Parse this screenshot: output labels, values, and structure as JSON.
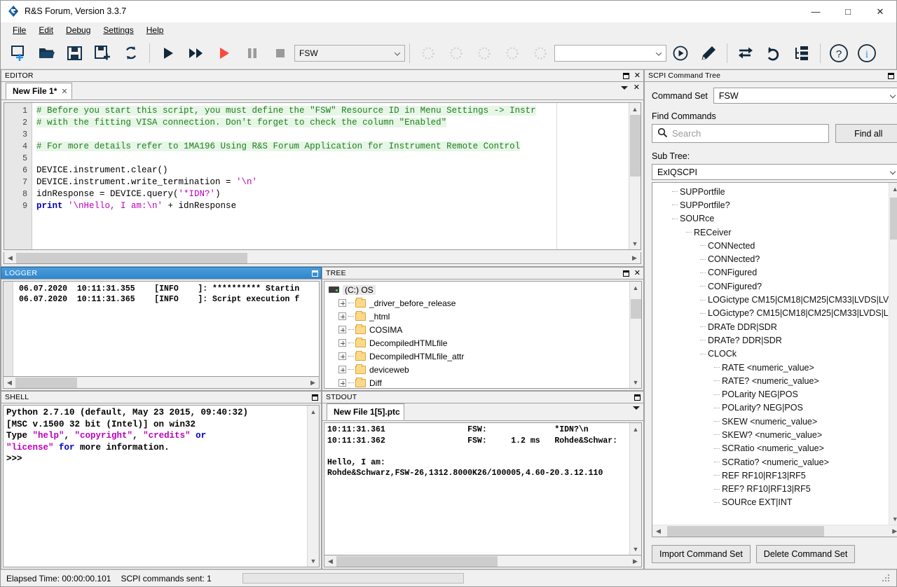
{
  "window": {
    "title": "R&S Forum, Version 3.3.7",
    "icon": "rs-logo-icon",
    "minimize": "—",
    "maximize": "□",
    "close": "✕"
  },
  "menu": {
    "items": [
      "File",
      "Edit",
      "Debug",
      "Settings",
      "Help"
    ]
  },
  "toolbar": {
    "buttons": [
      {
        "name": "new-file-icon",
        "title": "New File"
      },
      {
        "name": "open-folder-icon",
        "title": "Open"
      },
      {
        "name": "save-icon",
        "title": "Save"
      },
      {
        "name": "save-as-icon",
        "title": "Save As"
      },
      {
        "name": "refresh-icon",
        "title": "Reload"
      },
      {
        "name": "run-icon",
        "title": "Run"
      },
      {
        "name": "step-forward-icon",
        "title": "Run Fast"
      },
      {
        "name": "run-red-icon",
        "title": "Execute"
      },
      {
        "name": "pause-icon",
        "title": "Pause"
      },
      {
        "name": "stop-icon",
        "title": "Stop"
      }
    ],
    "device_combo": "FSW",
    "macro_combo": "",
    "right_buttons": [
      {
        "name": "play-circle-icon",
        "title": "Run Macro"
      },
      {
        "name": "pencil-icon",
        "title": "Edit Macro"
      },
      {
        "name": "swap-arrows-icon",
        "title": "Transfer"
      },
      {
        "name": "undo-icon",
        "title": "Undo"
      },
      {
        "name": "tree-list-icon",
        "title": "Command Tree"
      },
      {
        "name": "help-icon",
        "title": "Help"
      },
      {
        "name": "info-icon",
        "title": "Info"
      }
    ]
  },
  "editor": {
    "panel_title": "EDITOR",
    "tab_label": "New File 1*",
    "tab_close": "✕",
    "lines": [
      {
        "n": "1",
        "segments": [
          {
            "t": "# Before you start this script, you must define the \"FSW\" Resource ID in Menu Settings -> Instr",
            "c": "cm"
          }
        ]
      },
      {
        "n": "2",
        "segments": [
          {
            "t": "# with the fitting VISA connection. Don't forget to check the column \"Enabled\"",
            "c": "cm"
          }
        ]
      },
      {
        "n": "3",
        "segments": []
      },
      {
        "n": "4",
        "segments": [
          {
            "t": "# For more details refer to 1MA196 Using R&S Forum Application for Instrument Remote Control",
            "c": "cm"
          }
        ]
      },
      {
        "n": "5",
        "segments": []
      },
      {
        "n": "6",
        "segments": [
          {
            "t": "DEVICE.instrument.clear()",
            "c": ""
          }
        ]
      },
      {
        "n": "7",
        "segments": [
          {
            "t": "DEVICE.instrument.write_termination = ",
            "c": ""
          },
          {
            "t": "'\\n'",
            "c": "str-m"
          }
        ]
      },
      {
        "n": "8",
        "segments": [
          {
            "t": "idnResponse = DEVICE.query(",
            "c": ""
          },
          {
            "t": "'*IDN?'",
            "c": "str-m"
          },
          {
            "t": ")",
            "c": ""
          }
        ]
      },
      {
        "n": "9",
        "segments": [
          {
            "t": "print ",
            "c": "py-kw"
          },
          {
            "t": "'\\nHello, I am:\\n'",
            "c": "str-m"
          },
          {
            "t": " + idnResponse",
            "c": ""
          }
        ]
      }
    ]
  },
  "logger": {
    "panel_title": "LOGGER",
    "lines": [
      "06.07.2020  10:11:31.355    [INFO    ]: ********** Startin",
      "06.07.2020  10:11:31.365    [INFO    ]: Script execution f"
    ]
  },
  "tree": {
    "panel_title": "TREE",
    "items": [
      {
        "label": "(C:) OS",
        "indent": 0,
        "icon": "drive-icon",
        "expandable": false,
        "selected": true
      },
      {
        "label": "_driver_before_release",
        "indent": 1,
        "icon": "folder-icon",
        "expandable": true,
        "selected": false
      },
      {
        "label": "_html",
        "indent": 1,
        "icon": "folder-icon",
        "expandable": true,
        "selected": false
      },
      {
        "label": "COSIMA",
        "indent": 1,
        "icon": "folder-icon",
        "expandable": true,
        "selected": false
      },
      {
        "label": "DecompiledHTMLfile",
        "indent": 1,
        "icon": "folder-icon",
        "expandable": true,
        "selected": false
      },
      {
        "label": "DecompiledHTMLfile_attr",
        "indent": 1,
        "icon": "folder-icon",
        "expandable": true,
        "selected": false
      },
      {
        "label": "deviceweb",
        "indent": 1,
        "icon": "folder-icon",
        "expandable": true,
        "selected": false
      },
      {
        "label": "Diff",
        "indent": 1,
        "icon": "folder-icon",
        "expandable": true,
        "selected": false
      }
    ]
  },
  "shell": {
    "panel_title": "SHELL",
    "lines": [
      [
        {
          "t": "Python 2.7.10 (default, May 23 2015, 09:40:32)",
          "c": ""
        }
      ],
      [
        {
          "t": "[MSC v.1500 32 bit (Intel)] on win32",
          "c": ""
        }
      ],
      [
        {
          "t": "Type ",
          "c": ""
        },
        {
          "t": "\"help\"",
          "c": "s-str"
        },
        {
          "t": ", ",
          "c": ""
        },
        {
          "t": "\"copyright\"",
          "c": "s-str"
        },
        {
          "t": ", ",
          "c": ""
        },
        {
          "t": "\"credits\"",
          "c": "s-str"
        },
        {
          "t": " ",
          "c": ""
        },
        {
          "t": "or",
          "c": "s-kw"
        }
      ],
      [
        {
          "t": "\"license\"",
          "c": "s-str"
        },
        {
          "t": " ",
          "c": ""
        },
        {
          "t": "for",
          "c": "s-kw"
        },
        {
          "t": " more information.",
          "c": ""
        }
      ],
      [
        {
          "t": ">>>",
          "c": ""
        }
      ]
    ]
  },
  "stdout": {
    "panel_title": "STDOUT",
    "tab_label": "New File 1[5].ptc",
    "lines": [
      "10:11:31.361                 FSW:              *IDN?\\n",
      "10:11:31.362                 FSW:     1.2 ms   Rohde&Schwar:",
      "",
      "Hello, I am:",
      "Rohde&Schwarz,FSW-26,1312.8000K26/100005,4.60-20.3.12.110"
    ]
  },
  "scpi": {
    "panel_title": "SCPI Command Tree",
    "command_set_label": "Command Set",
    "command_set_value": "FSW",
    "find_label": "Find Commands",
    "search_placeholder": "Search",
    "search_value": "",
    "find_all_label": "Find all",
    "sub_tree_label": "Sub Tree:",
    "sub_tree_value": "ExIQSCPI",
    "import_label": "Import Command Set",
    "delete_label": "Delete Command Set",
    "items": [
      {
        "label": "SUPPortfile",
        "indent": 1
      },
      {
        "label": "SUPPortfile?",
        "indent": 1
      },
      {
        "label": "SOURce",
        "indent": 1
      },
      {
        "label": "RECeiver",
        "indent": 2
      },
      {
        "label": "CONNected",
        "indent": 3
      },
      {
        "label": "CONNected?",
        "indent": 3
      },
      {
        "label": "CONFigured",
        "indent": 3
      },
      {
        "label": "CONFigured?",
        "indent": 3
      },
      {
        "label": "LOGictype CM15|CM18|CM25|CM33|LVDS|LV",
        "indent": 3
      },
      {
        "label": "LOGictype? CM15|CM18|CM25|CM33|LVDS|L",
        "indent": 3
      },
      {
        "label": "DRATe DDR|SDR",
        "indent": 3
      },
      {
        "label": "DRATe? DDR|SDR",
        "indent": 3
      },
      {
        "label": "CLOCk",
        "indent": 3
      },
      {
        "label": "RATE <numeric_value>",
        "indent": 4
      },
      {
        "label": "RATE? <numeric_value>",
        "indent": 4
      },
      {
        "label": "POLarity NEG|POS",
        "indent": 4
      },
      {
        "label": "POLarity? NEG|POS",
        "indent": 4
      },
      {
        "label": "SKEW <numeric_value>",
        "indent": 4
      },
      {
        "label": "SKEW? <numeric_value>",
        "indent": 4
      },
      {
        "label": "SCRatio <numeric_value>",
        "indent": 4
      },
      {
        "label": "SCRatio? <numeric_value>",
        "indent": 4
      },
      {
        "label": "REF RF10|RF13|RF5",
        "indent": 4
      },
      {
        "label": "REF? RF10|RF13|RF5",
        "indent": 4
      },
      {
        "label": "SOURce EXT|INT",
        "indent": 4
      }
    ]
  },
  "statusbar": {
    "elapsed": "Elapsed Time: 00:00:00.101",
    "commands_sent": "SCPI commands sent: 1",
    "progress_percent": 0
  }
}
